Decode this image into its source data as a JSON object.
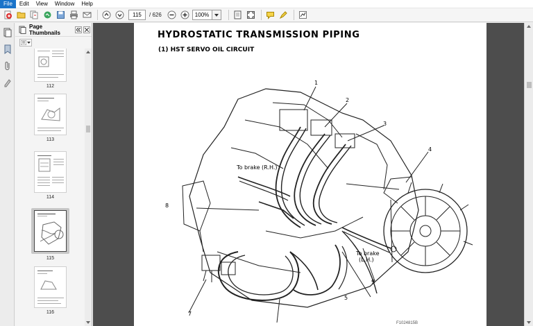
{
  "menu": [
    "File",
    "Edit",
    "View",
    "Window",
    "Help"
  ],
  "toolbar": {
    "current_page": "115",
    "total_pages": "/ 626",
    "zoom": "100%"
  },
  "thumbnails_panel": {
    "title": "Page Thumbnails",
    "pages": [
      {
        "label": "112",
        "selected": false
      },
      {
        "label": "113",
        "selected": false
      },
      {
        "label": "114",
        "selected": false
      },
      {
        "label": "115",
        "selected": true
      },
      {
        "label": "116",
        "selected": false
      }
    ]
  },
  "document": {
    "title": "HYDROSTATIC  TRANSMISSION  PIPING",
    "subtitle": "(1)  HST SERVO OIL CIRCUIT",
    "labels": {
      "brake_rh": "To brake (R.H.)",
      "brake_lh_1": "To brake",
      "brake_lh_2": "(L.H.)"
    },
    "callouts": [
      "1",
      "2",
      "3",
      "4",
      "5",
      "7",
      "8",
      "9"
    ],
    "footer_code": "F1024815B"
  },
  "colors": {
    "accent": "#1a73c9",
    "doc_background": "#4d4d4d"
  }
}
